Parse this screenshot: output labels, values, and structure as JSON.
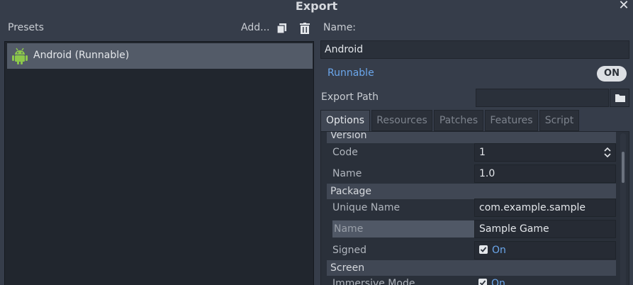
{
  "window": {
    "title": "Export"
  },
  "presets": {
    "label": "Presets",
    "add_label": "Add...",
    "items": [
      {
        "label": "Android (Runnable)"
      }
    ]
  },
  "preset": {
    "name_label": "Name:",
    "name_value": "Android",
    "runnable_label": "Runnable",
    "runnable_toggle": "ON",
    "export_path_label": "Export Path",
    "export_path_value": ""
  },
  "tabs": [
    {
      "label": "Options",
      "active": true
    },
    {
      "label": "Resources",
      "active": false
    },
    {
      "label": "Patches",
      "active": false
    },
    {
      "label": "Features",
      "active": false
    },
    {
      "label": "Script",
      "active": false
    }
  ],
  "options": {
    "version": {
      "header": "Version",
      "code_label": "Code",
      "code_value": "1",
      "name_label": "Name",
      "name_value": "1.0"
    },
    "package": {
      "header": "Package",
      "unique_name_label": "Unique Name",
      "unique_name_value": "com.example.sample",
      "name_label": "Name",
      "name_value": "Sample Game",
      "signed_label": "Signed",
      "signed_value": "On"
    },
    "screen": {
      "header": "Screen",
      "immersive_label": "Immersive Mode",
      "immersive_value": "On"
    }
  },
  "colors": {
    "accent": "#6ba7ec",
    "android_green": "#8cc84b",
    "background": "#363d4a"
  },
  "icons": [
    "close-icon",
    "duplicate-icon",
    "trash-icon",
    "android-icon",
    "folder-icon",
    "spinner-arrows-icon",
    "checkmark-icon"
  ]
}
